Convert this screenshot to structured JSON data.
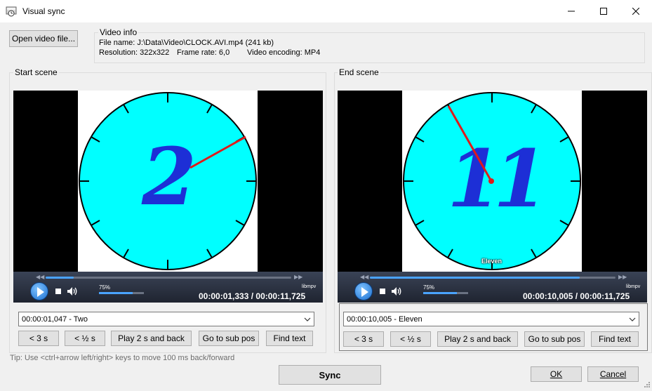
{
  "window": {
    "title": "Visual sync",
    "icon": "video-sync-app-icon",
    "controls": [
      "minimize-icon",
      "maximize-icon",
      "close-icon"
    ]
  },
  "toolbar": {
    "open_video_label": "Open video file..."
  },
  "video_info": {
    "heading": "Video info",
    "file_name": "File name: J:\\Data\\Video\\CLOCK.AVI.mp4 (241 kb)",
    "resolution": "Resolution: 322x322",
    "frame_rate": "Frame rate: 6,0",
    "encoding": "Video encoding: MP4"
  },
  "start_scene": {
    "heading": "Start scene",
    "clock_numeral": "2",
    "player": {
      "volume_label": "75%",
      "volume_level": 0.75,
      "engine_label": "libmpv",
      "time": "00:00:01,333 / 00:00:11,725",
      "progress": 0.114
    },
    "subtitle_select": "00:00:01,047 - Two",
    "buttons": {
      "back3": "< 3 s",
      "back_half": "< ½ s",
      "play2": "Play 2 s and back",
      "goto_sub": "Go to sub pos",
      "find_text": "Find text"
    }
  },
  "end_scene": {
    "heading": "End scene",
    "clock_numeral": "11",
    "caption": "Eleven",
    "player": {
      "volume_label": "75%",
      "volume_level": 0.75,
      "engine_label": "libmpv",
      "time": "00:00:10,005 / 00:00:11,725",
      "progress": 0.853
    },
    "subtitle_select": "00:00:10,005 - Eleven",
    "buttons": {
      "back3": "< 3 s",
      "back_half": "< ½ s",
      "play2": "Play 2 s and back",
      "goto_sub": "Go to sub pos",
      "find_text": "Find text"
    }
  },
  "tip": "Tip: Use <ctrl+arrow left/right> keys to move 100 ms back/forward",
  "footer": {
    "sync_label": "Sync",
    "ok_label": "OK",
    "cancel_label": "Cancel"
  },
  "colors": {
    "clock_face": "#00ffff",
    "numeral": "#1d2fd6",
    "hand": "#e01a1a",
    "accent": "#4aa3ff"
  }
}
